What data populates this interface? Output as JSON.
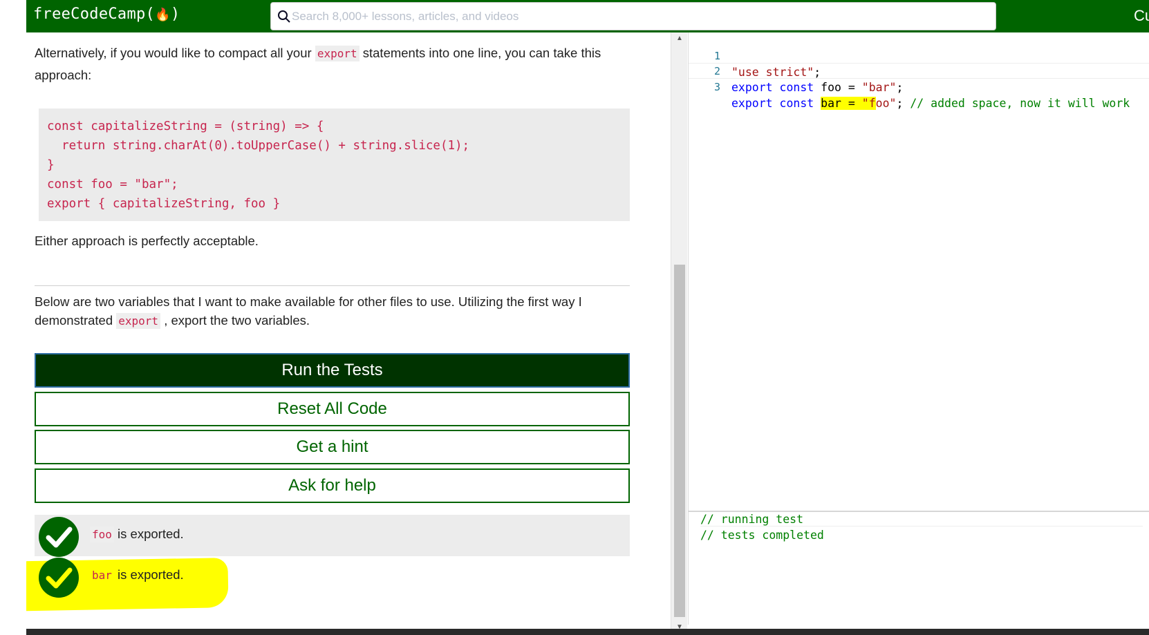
{
  "navbar": {
    "logo_text": "freeCodeCamp(",
    "logo_flame": "🔥",
    "logo_close": ")",
    "search_placeholder": "Search 8,000+ lessons, articles, and videos",
    "right_text": "Cu",
    "colors": {
      "background": "#006400",
      "text": "#ffffff"
    }
  },
  "instructions": {
    "para1_before": "Alternatively, if you would like to compact all your ",
    "para1_code": "export",
    "para1_after": " statements into one line, you can take this approach:",
    "code_lines": [
      "const capitalizeString = (string) => {",
      "  return string.charAt(0).toUpperCase() + string.slice(1);",
      "}",
      "const foo = \"bar\";",
      "export { capitalizeString, foo }"
    ],
    "para2": "Either approach is perfectly acceptable.",
    "para3_before": "Below are two variables that I want to make available for other files to use. Utilizing the first way I demonstrated ",
    "para3_code": "export",
    "para3_after": " , export the two variables."
  },
  "buttons": {
    "run": "Run the Tests",
    "reset": "Reset All Code",
    "hint": "Get a hint",
    "help": "Ask for help"
  },
  "tests": [
    {
      "code": "foo",
      "text": " is exported.",
      "passed": true
    },
    {
      "code": "bar",
      "text": " is exported.",
      "passed": true
    }
  ],
  "editor": {
    "lines": [
      {
        "num": "1",
        "text": "\"use strict\";"
      },
      {
        "num": "2",
        "text": "export const foo = \"bar\";"
      },
      {
        "num": "3",
        "text": "export const bar = \"foo\"; // added space, now it will work"
      }
    ],
    "line1": {
      "str": "\"use strict\"",
      "semi": ";"
    },
    "line2": {
      "kw1": "export",
      "kw2": "const",
      "ident": "foo",
      "op": "=",
      "str": "\"bar\"",
      "semi": ";"
    },
    "line3": {
      "kw1": "export",
      "kw2": "const",
      "ident_hl": "bar",
      "op_hl": "=",
      "str_hl": "\"f",
      "str_rest": "oo\"",
      "semi": ";",
      "comment": "// added space, now it will work"
    }
  },
  "console": {
    "lines": [
      "// running test",
      "// tests completed"
    ]
  },
  "colors": {
    "accent": "#006400",
    "run_button_bg": "#003300",
    "inline_code": "#c7254e",
    "highlight": "#ffff00"
  }
}
